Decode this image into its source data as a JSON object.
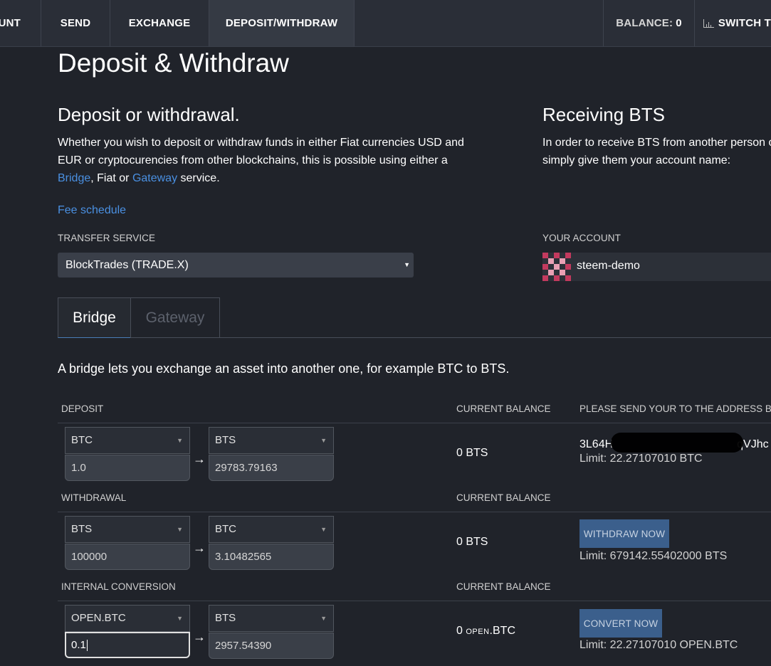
{
  "nav": {
    "account": "UNT",
    "send": "SEND",
    "exchange": "EXCHANGE",
    "deposit": "DEPOSIT/WITHDRAW",
    "balance_label": "BALANCE:",
    "balance_value": "0",
    "switch": "SWITCH T",
    "switch_icon": "bar-chart-icon"
  },
  "page": {
    "title": "Deposit & Withdraw"
  },
  "deposit_section": {
    "heading": "Deposit or withdrawal.",
    "text1": "Whether you wish to deposit or withdraw funds in either Fiat currencies USD and",
    "text2": "EUR or cryptocurencies from other blockchains, this is possible using either a",
    "link_bridge": "Bridge",
    "text3": ", Fiat or ",
    "link_gateway": "Gateway",
    "text4": " service.",
    "fee_link": "Fee schedule",
    "transfer_label": "TRANSFER SERVICE",
    "transfer_value": "BlockTrades (TRADE.X)"
  },
  "receiving_section": {
    "heading": "Receiving BTS",
    "text1": "In order to receive BTS from another person o",
    "text2": "simply give them your account name:",
    "account_label": "YOUR ACCOUNT",
    "account_name": "steem-demo"
  },
  "tabs": {
    "bridge": "Bridge",
    "gateway": "Gateway"
  },
  "bridge_desc": "A bridge lets you exchange an asset into another one, for example BTC to BTS.",
  "table": {
    "deposit": {
      "header": "DEPOSIT",
      "balance_header": "CURRENT BALANCE",
      "address_header": "PLEASE SEND YOUR TO THE ADDRESS BELOW",
      "from_asset": "BTC",
      "to_asset": "BTS",
      "from_amount": "1.0",
      "to_amount": "29783.79163",
      "balance": "0 BTS",
      "address_start": "3L64H",
      "address_end": "qVJhc",
      "limit": "Limit: 22.27107010 BTC"
    },
    "withdrawal": {
      "header": "WITHDRAWAL",
      "balance_header": "CURRENT BALANCE",
      "from_asset": "BTS",
      "to_asset": "BTC",
      "from_amount": "100000",
      "to_amount": "3.10482565",
      "balance": "0 BTS",
      "button": "WITHDRAW NOW",
      "limit": "Limit: 679142.55402000 BTS"
    },
    "conversion": {
      "header": "INTERNAL CONVERSION",
      "balance_header": "CURRENT BALANCE",
      "from_asset": "OPEN.BTC",
      "to_asset": "BTS",
      "from_amount": "0.1",
      "to_amount": "2957.54390",
      "balance_num": "0",
      "balance_prefix": "OPEN",
      "balance_suffix": ".BTC",
      "button": "CONVERT NOW",
      "limit": "Limit: 22.27107010 OPEN.BTC"
    },
    "arrow": "→",
    "caret": "▼"
  },
  "colors": {
    "background": "#20232a",
    "nav": "#2a2e37",
    "link": "#4a90e2",
    "button": "#3b5f8c"
  }
}
